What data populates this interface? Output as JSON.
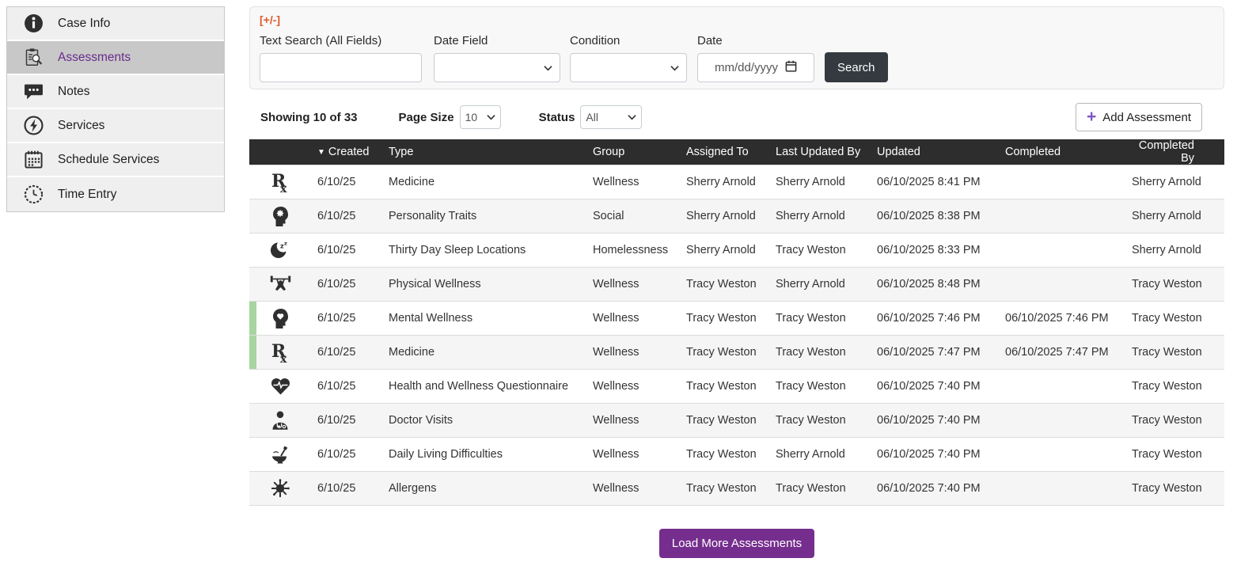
{
  "sidebar": {
    "items": [
      {
        "label": "Case Info",
        "icon": "info-icon",
        "selected": false
      },
      {
        "label": "Assessments",
        "icon": "assessments-icon",
        "selected": true
      },
      {
        "label": "Notes",
        "icon": "notes-icon",
        "selected": false
      },
      {
        "label": "Services",
        "icon": "services-icon",
        "selected": false
      },
      {
        "label": "Schedule Services",
        "icon": "schedule-icon",
        "selected": false
      },
      {
        "label": "Time Entry",
        "icon": "clock-icon",
        "selected": false
      }
    ]
  },
  "filters": {
    "toggle_label": "[+/-]",
    "text_search_label": "Text Search (All Fields)",
    "date_field_label": "Date Field",
    "condition_label": "Condition",
    "date_label": "Date",
    "date_placeholder": "mm/dd/yyyy",
    "search_button": "Search"
  },
  "toolbar": {
    "showing_text": "Showing 10 of 33",
    "page_size_label": "Page Size",
    "page_size_value": "10",
    "status_label": "Status",
    "status_value": "All",
    "add_button": "Add Assessment",
    "add_button_icon": "plus-icon"
  },
  "table": {
    "sort_indicator": "▼",
    "headers": [
      "Created",
      "Type",
      "Group",
      "Assigned To",
      "Last Updated By",
      "Updated",
      "Completed",
      "Completed By"
    ],
    "rows": [
      {
        "icon": "rx-icon",
        "created": "6/10/25",
        "type": "Medicine",
        "group": "Wellness",
        "assigned_to": "Sherry Arnold",
        "last_updated_by": "Sherry Arnold",
        "updated": "06/10/2025 8:41 PM",
        "completed": "",
        "completed_by": "Sherry Arnold",
        "flag": false
      },
      {
        "icon": "personality-traits-icon",
        "created": "6/10/25",
        "type": "Personality Traits",
        "group": "Social",
        "assigned_to": "Sherry Arnold",
        "last_updated_by": "Sherry Arnold",
        "updated": "06/10/2025 8:38 PM",
        "completed": "",
        "completed_by": "Sherry Arnold",
        "flag": false
      },
      {
        "icon": "sleep-icon",
        "created": "6/10/25",
        "type": "Thirty Day Sleep Locations",
        "group": "Homelessness",
        "assigned_to": "Sherry Arnold",
        "last_updated_by": "Tracy Weston",
        "updated": "06/10/2025 8:33 PM",
        "completed": "",
        "completed_by": "Sherry Arnold",
        "flag": false
      },
      {
        "icon": "physical-wellness-icon",
        "created": "6/10/25",
        "type": "Physical Wellness",
        "group": "Wellness",
        "assigned_to": "Tracy Weston",
        "last_updated_by": "Sherry Arnold",
        "updated": "06/10/2025 8:48 PM",
        "completed": "",
        "completed_by": "Tracy Weston",
        "flag": false
      },
      {
        "icon": "mental-wellness-icon",
        "created": "6/10/25",
        "type": "Mental Wellness",
        "group": "Wellness",
        "assigned_to": "Tracy Weston",
        "last_updated_by": "Tracy Weston",
        "updated": "06/10/2025 7:46 PM",
        "completed": "06/10/2025 7:46 PM",
        "completed_by": "Tracy Weston",
        "flag": true
      },
      {
        "icon": "rx-icon",
        "created": "6/10/25",
        "type": "Medicine",
        "group": "Wellness",
        "assigned_to": "Tracy Weston",
        "last_updated_by": "Tracy Weston",
        "updated": "06/10/2025 7:47 PM",
        "completed": "06/10/2025 7:47 PM",
        "completed_by": "Tracy Weston",
        "flag": true
      },
      {
        "icon": "health-wellness-icon",
        "created": "6/10/25",
        "type": "Health and Wellness Questionnaire",
        "group": "Wellness",
        "assigned_to": "Tracy Weston",
        "last_updated_by": "Tracy Weston",
        "updated": "06/10/2025 7:40 PM",
        "completed": "",
        "completed_by": "Tracy Weston",
        "flag": false
      },
      {
        "icon": "doctor-icon",
        "created": "6/10/25",
        "type": "Doctor Visits",
        "group": "Wellness",
        "assigned_to": "Tracy Weston",
        "last_updated_by": "Tracy Weston",
        "updated": "06/10/2025 7:40 PM",
        "completed": "",
        "completed_by": "Tracy Weston",
        "flag": false
      },
      {
        "icon": "daily-living-icon",
        "created": "6/10/25",
        "type": "Daily Living Difficulties",
        "group": "Wellness",
        "assigned_to": "Tracy Weston",
        "last_updated_by": "Sherry Arnold",
        "updated": "06/10/2025 7:40 PM",
        "completed": "",
        "completed_by": "Tracy Weston",
        "flag": false
      },
      {
        "icon": "allergens-icon",
        "created": "6/10/25",
        "type": "Allergens",
        "group": "Wellness",
        "assigned_to": "Tracy Weston",
        "last_updated_by": "Tracy Weston",
        "updated": "06/10/2025 7:40 PM",
        "completed": "",
        "completed_by": "Tracy Weston",
        "flag": false
      }
    ]
  },
  "footer": {
    "load_more_button": "Load More Assessments"
  },
  "colors": {
    "purple_text": "#6a2b8d",
    "plus_purple": "#7e57c2",
    "load_purple": "#762e8e",
    "orange": "#e0592a",
    "flag_green": "#a8d4a2",
    "header_dark": "#2d2d2d",
    "dark_button": "#343a40"
  }
}
